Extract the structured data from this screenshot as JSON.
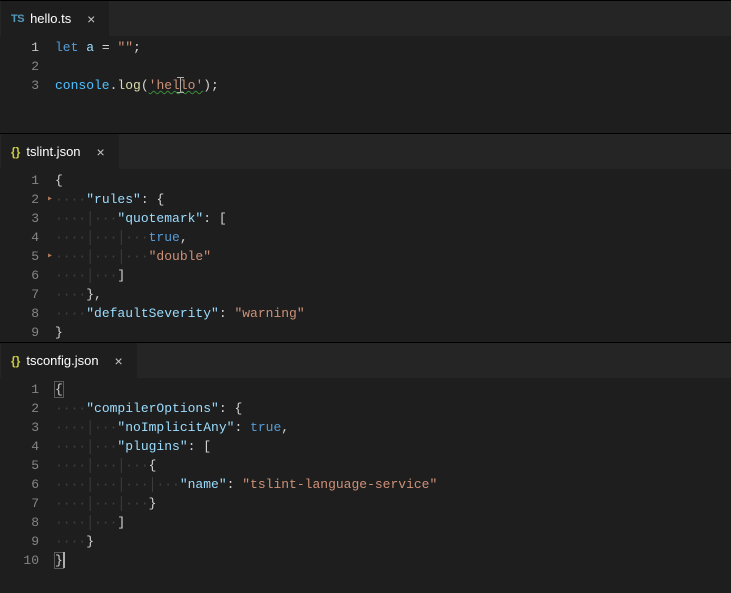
{
  "panes": [
    {
      "tab": {
        "icon": "ts",
        "name": "hello.ts"
      },
      "lines": [
        [
          {
            "cls": "c-key",
            "t": "let "
          },
          {
            "cls": "c-var",
            "t": "a"
          },
          {
            "cls": "c-op",
            "t": " = "
          },
          {
            "cls": "c-str",
            "t": "\"\""
          },
          {
            "cls": "c-punc",
            "t": ";"
          }
        ],
        [],
        [
          {
            "cls": "c-obj",
            "t": "console"
          },
          {
            "cls": "c-punc",
            "t": "."
          },
          {
            "cls": "c-fun",
            "t": "log"
          },
          {
            "cls": "c-punc",
            "t": "("
          },
          {
            "cls": "c-str wavy",
            "t": "'hello'"
          },
          {
            "cls": "c-punc",
            "t": ");"
          }
        ]
      ],
      "activeLine": 1,
      "showTextCursorOnLine3": true,
      "cursorColBeforeChar": 17,
      "extraBlankBelow": 2
    },
    {
      "tab": {
        "icon": "json",
        "name": "tslint.json"
      },
      "foldMarkers": [
        2,
        5
      ],
      "lines": [
        [
          {
            "cls": "c-brace",
            "t": "{"
          }
        ],
        [
          {
            "cls": "c-guide",
            "t": "····"
          },
          {
            "cls": "c-prop",
            "t": "\"rules\""
          },
          {
            "cls": "c-punc",
            "t": ": "
          },
          {
            "cls": "c-brace",
            "t": "{"
          }
        ],
        [
          {
            "cls": "c-guide",
            "t": "····│···"
          },
          {
            "cls": "c-prop",
            "t": "\"quotemark\""
          },
          {
            "cls": "c-punc",
            "t": ": "
          },
          {
            "cls": "c-brace",
            "t": "["
          }
        ],
        [
          {
            "cls": "c-guide",
            "t": "····│···│···"
          },
          {
            "cls": "c-bool",
            "t": "true"
          },
          {
            "cls": "c-punc",
            "t": ","
          }
        ],
        [
          {
            "cls": "c-guide",
            "t": "····│···│···"
          },
          {
            "cls": "c-str",
            "t": "\"double\""
          }
        ],
        [
          {
            "cls": "c-guide",
            "t": "····│···"
          },
          {
            "cls": "c-brace",
            "t": "]"
          }
        ],
        [
          {
            "cls": "c-guide",
            "t": "····"
          },
          {
            "cls": "c-brace",
            "t": "}"
          },
          {
            "cls": "c-punc",
            "t": ","
          }
        ],
        [
          {
            "cls": "c-guide",
            "t": "····"
          },
          {
            "cls": "c-prop",
            "t": "\"defaultSeverity\""
          },
          {
            "cls": "c-punc",
            "t": ": "
          },
          {
            "cls": "c-str",
            "t": "\"warning\""
          }
        ],
        [
          {
            "cls": "c-brace",
            "t": "}"
          }
        ]
      ]
    },
    {
      "tab": {
        "icon": "json",
        "name": "tsconfig.json"
      },
      "lines": [
        [
          {
            "cls": "c-brace sel-brace",
            "t": "{"
          }
        ],
        [
          {
            "cls": "c-guide",
            "t": "····"
          },
          {
            "cls": "c-prop",
            "t": "\"compilerOptions\""
          },
          {
            "cls": "c-punc",
            "t": ": "
          },
          {
            "cls": "c-brace",
            "t": "{"
          }
        ],
        [
          {
            "cls": "c-guide",
            "t": "····│···"
          },
          {
            "cls": "c-prop",
            "t": "\"noImplicitAny\""
          },
          {
            "cls": "c-punc",
            "t": ": "
          },
          {
            "cls": "c-bool",
            "t": "true"
          },
          {
            "cls": "c-punc",
            "t": ","
          }
        ],
        [
          {
            "cls": "c-guide",
            "t": "····│···"
          },
          {
            "cls": "c-prop",
            "t": "\"plugins\""
          },
          {
            "cls": "c-punc",
            "t": ": "
          },
          {
            "cls": "c-brace",
            "t": "["
          }
        ],
        [
          {
            "cls": "c-guide",
            "t": "····│···│···"
          },
          {
            "cls": "c-brace",
            "t": "{"
          }
        ],
        [
          {
            "cls": "c-guide",
            "t": "····│···│···│···"
          },
          {
            "cls": "c-prop",
            "t": "\"name\""
          },
          {
            "cls": "c-punc",
            "t": ": "
          },
          {
            "cls": "c-str",
            "t": "\"tslint-language-service\""
          }
        ],
        [
          {
            "cls": "c-guide",
            "t": "····│···│···"
          },
          {
            "cls": "c-brace",
            "t": "}"
          }
        ],
        [
          {
            "cls": "c-guide",
            "t": "····│···"
          },
          {
            "cls": "c-brace",
            "t": "]"
          }
        ],
        [
          {
            "cls": "c-guide",
            "t": "····"
          },
          {
            "cls": "c-brace",
            "t": "}"
          }
        ],
        [
          {
            "cls": "c-brace sel-brace",
            "t": "}"
          },
          {
            "cls": "",
            "t": "",
            "cursor": true
          }
        ]
      ]
    }
  ]
}
